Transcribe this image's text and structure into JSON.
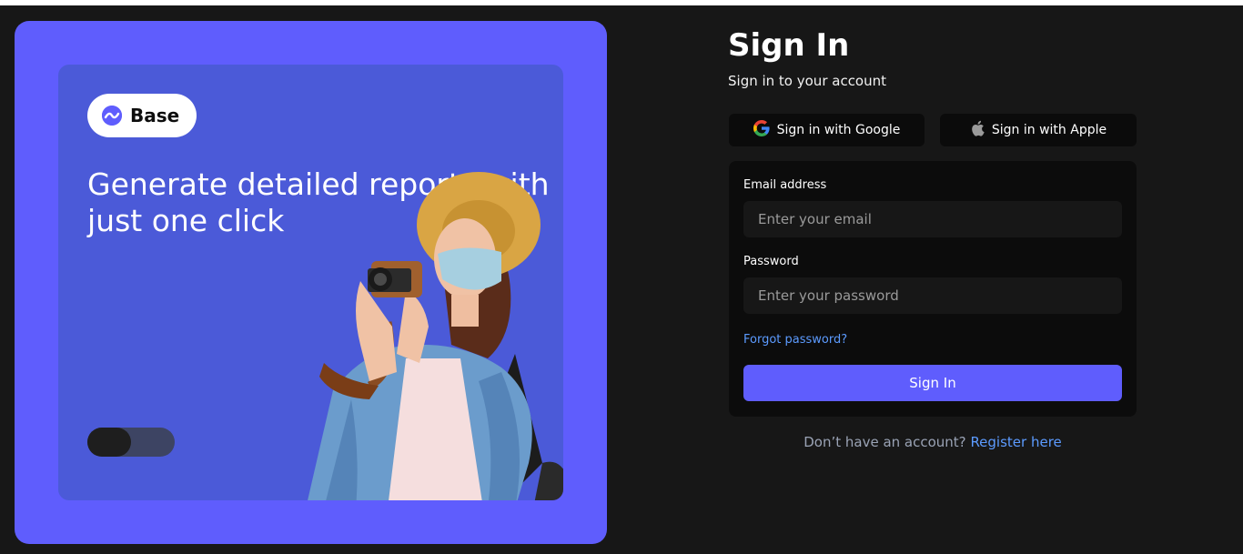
{
  "brand": {
    "name": "Base",
    "color": "#5f5dfd"
  },
  "hero": {
    "headline": "Generate detailed reports with just one click",
    "toggle_state": "off"
  },
  "signin": {
    "title": "Sign In",
    "subtitle": "Sign in to your account",
    "google_label": "Sign in with Google",
    "apple_label": "Sign in with Apple",
    "email_label": "Email address",
    "email_placeholder": "Enter your email",
    "email_value": "",
    "password_label": "Password",
    "password_placeholder": "Enter your password",
    "password_value": "",
    "forgot_label": "Forgot password?",
    "submit_label": "Sign In",
    "register_prompt": "Don’t have an account?",
    "register_link": "Register here"
  },
  "colors": {
    "background": "#171717",
    "accent": "#5f5dfd",
    "link": "#5c9bff",
    "card": "#0c0c0c"
  },
  "icons": [
    "base-logo-icon",
    "google-icon",
    "apple-icon"
  ]
}
